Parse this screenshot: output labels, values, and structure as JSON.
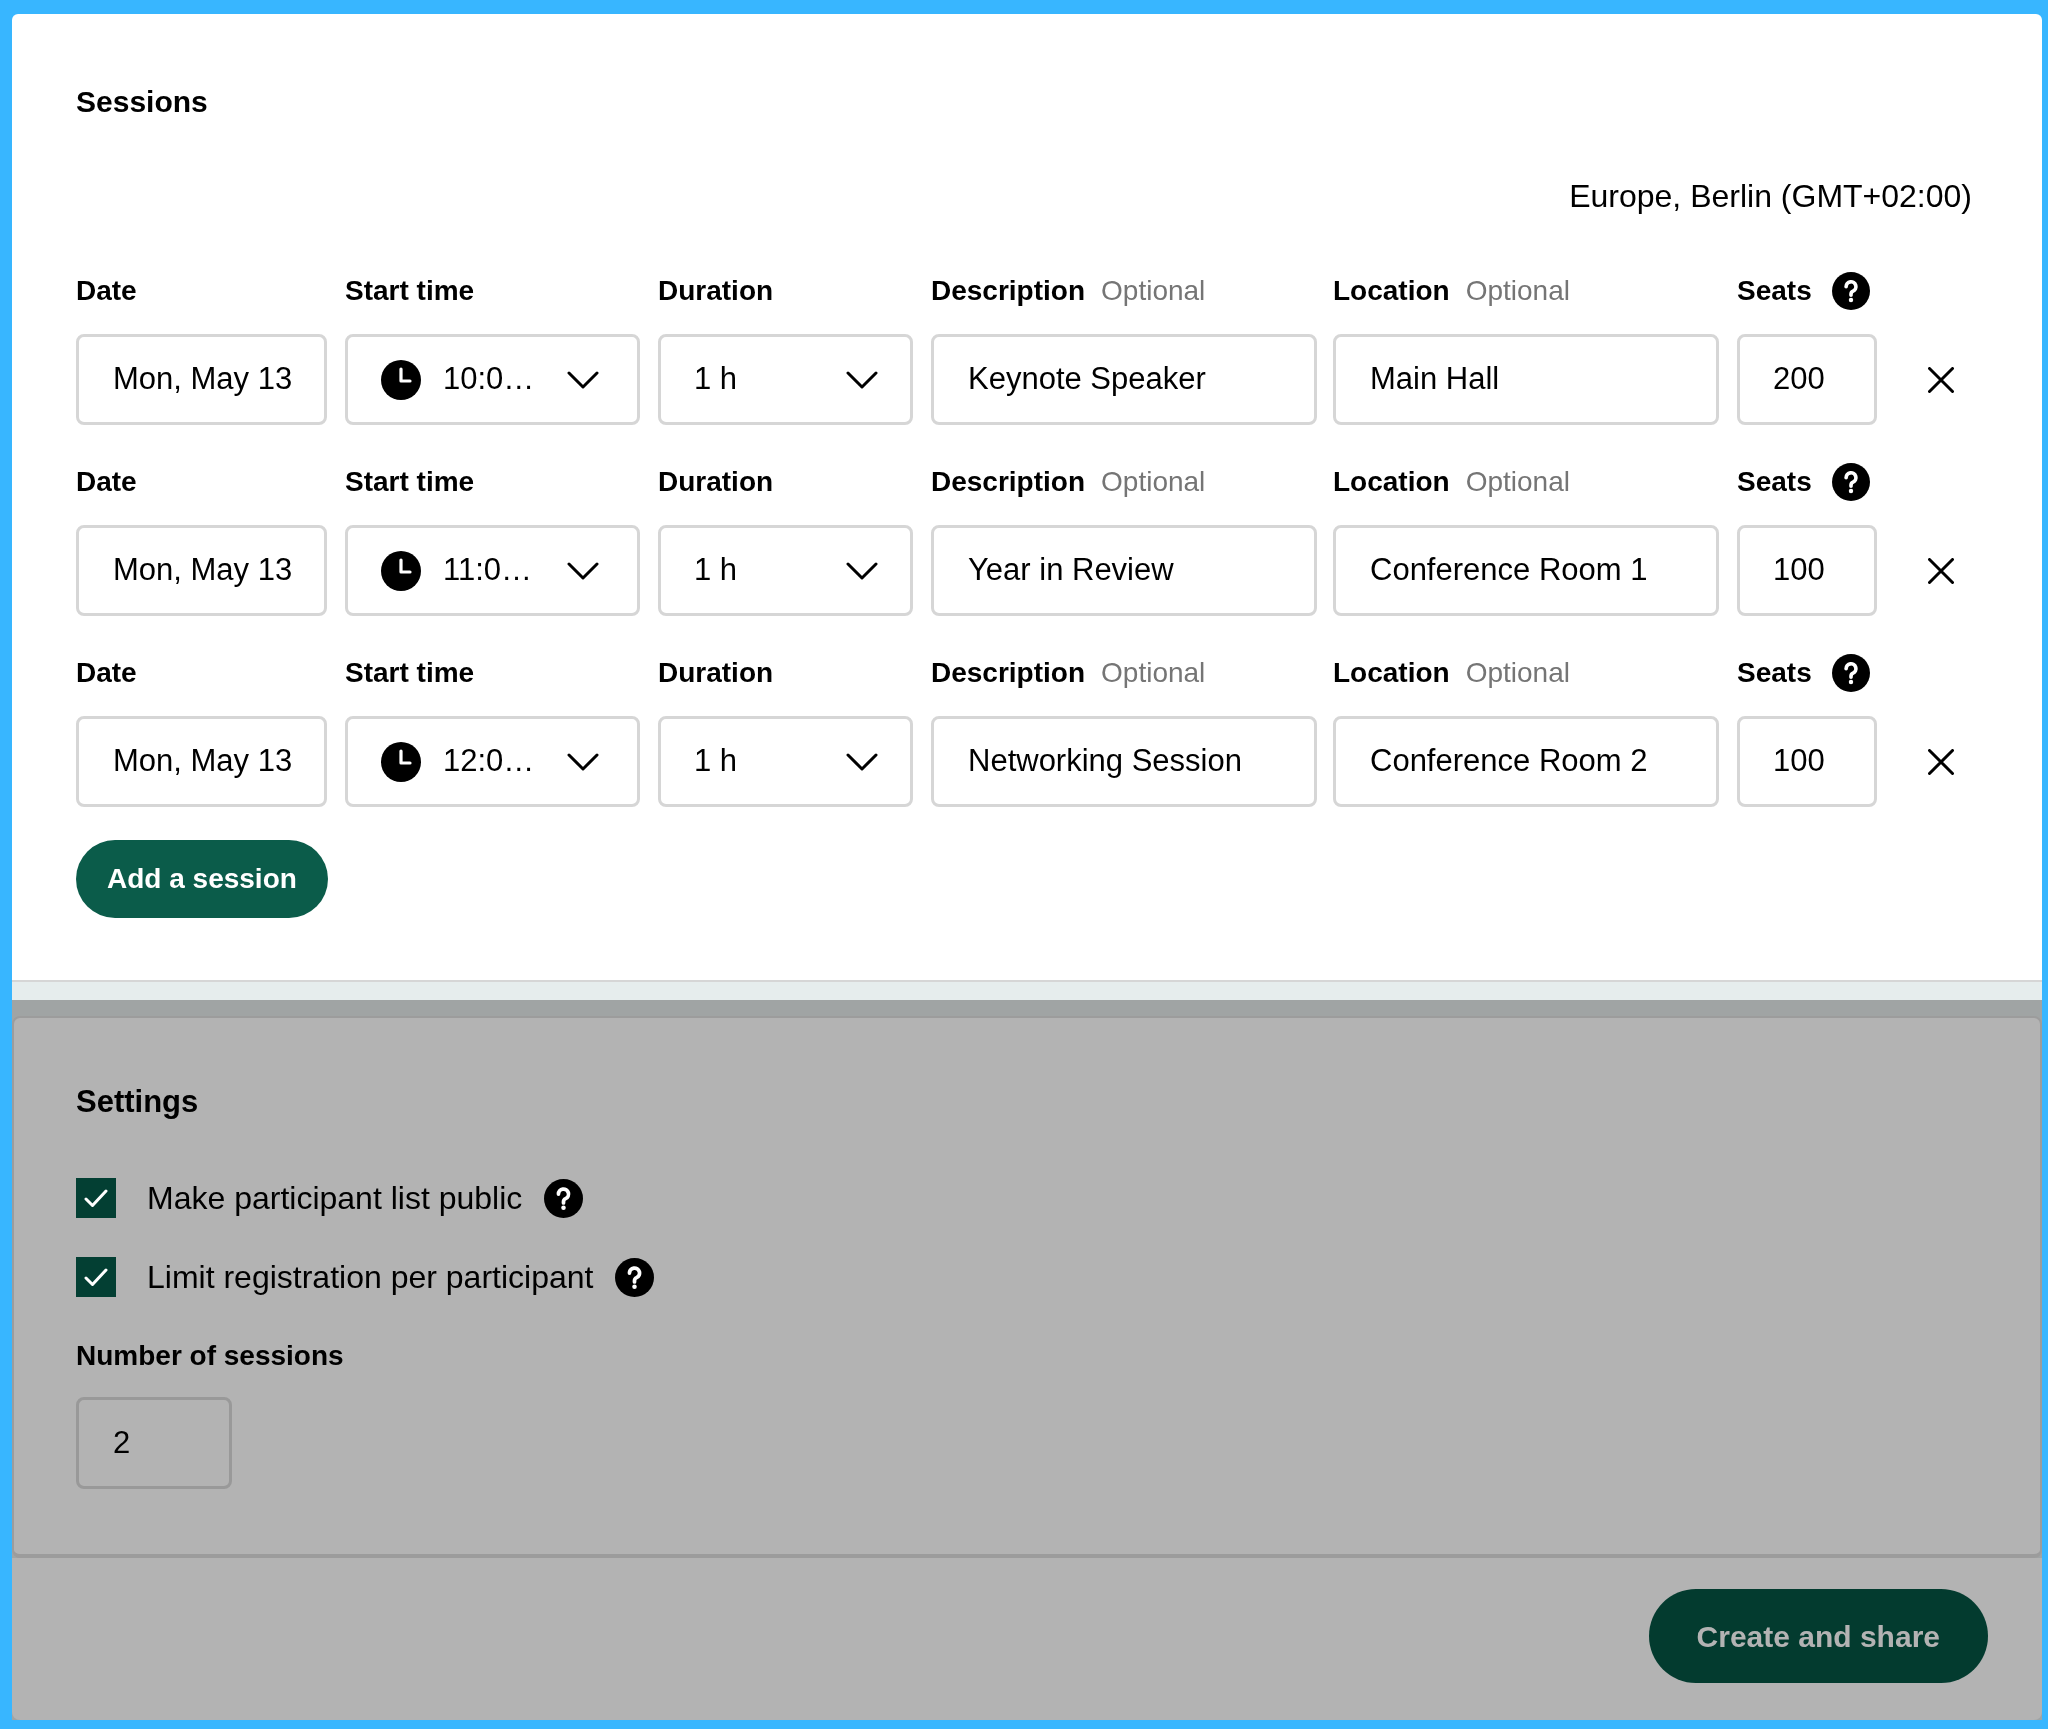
{
  "sessions": {
    "title": "Sessions",
    "timezone": "Europe, Berlin (GMT+02:00)",
    "rows": [
      {
        "date_label": "Date",
        "date": "Mon, May 13",
        "start_label": "Start time",
        "start_time": "10:0…",
        "duration_label": "Duration",
        "duration": "1 h",
        "description_label": "Description",
        "description_hint": "Optional",
        "description": "Keynote Speaker",
        "location_label": "Location",
        "location_hint": "Optional",
        "location": "Main Hall",
        "seats_label": "Seats",
        "seats": "200"
      },
      {
        "date_label": "Date",
        "date": "Mon, May 13",
        "start_label": "Start time",
        "start_time": "11:0…",
        "duration_label": "Duration",
        "duration": "1 h",
        "description_label": "Description",
        "description_hint": "Optional",
        "description": "Year in Review",
        "location_label": "Location",
        "location_hint": "Optional",
        "location": "Conference Room 1",
        "seats_label": "Seats",
        "seats": "100"
      },
      {
        "date_label": "Date",
        "date": "Mon, May 13",
        "start_label": "Start time",
        "start_time": "12:0…",
        "duration_label": "Duration",
        "duration": "1 h",
        "description_label": "Description",
        "description_hint": "Optional",
        "description": "Networking Session",
        "location_label": "Location",
        "location_hint": "Optional",
        "location": "Conference Room 2",
        "seats_label": "Seats",
        "seats": "100"
      }
    ],
    "add_button": "Add a session"
  },
  "settings": {
    "title": "Settings",
    "options": [
      {
        "label": "Make participant list public",
        "checked": true
      },
      {
        "label": "Limit registration per participant",
        "checked": true
      }
    ],
    "sessions_count_label": "Number of sessions",
    "sessions_count": "2"
  },
  "footer": {
    "primary_button": "Create and share"
  }
}
